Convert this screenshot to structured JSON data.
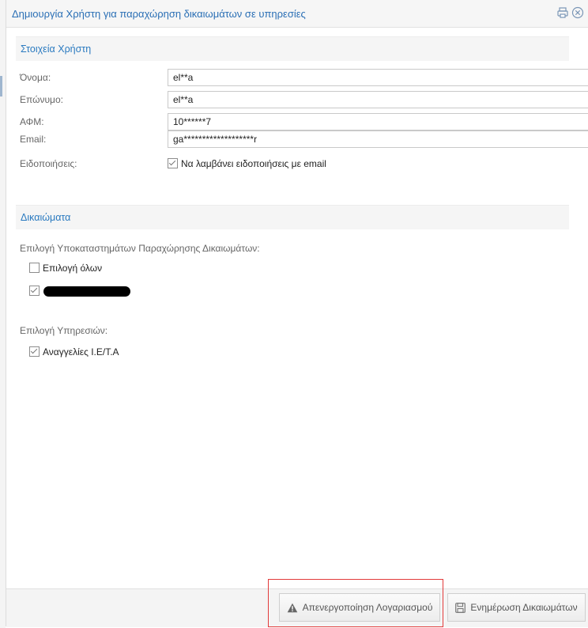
{
  "dialog": {
    "title": "Δημιουργία Χρήστη για παραχώρηση δικαιωμάτων σε υπηρεσίες",
    "icons": [
      "print-icon",
      "close-icon"
    ]
  },
  "user_section": {
    "title": "Στοιχεία Χρήστη",
    "fields": {
      "first_name": {
        "label": "Όνομα:",
        "value": "el**a"
      },
      "last_name": {
        "label": "Επώνυμο:",
        "value": "el**a"
      },
      "afm": {
        "label": "ΑΦΜ:",
        "value": "10******7"
      },
      "email": {
        "label": "Email:",
        "value": "ga*******************r"
      }
    },
    "notifications": {
      "label": "Ειδοποιήσεις:",
      "checkbox_label": "Να λαμβάνει ειδοποιήσεις με email",
      "checked": true
    }
  },
  "rights_section": {
    "title": "Δικαιώματα",
    "branches_label": "Επιλογή Υποκαταστημάτων Παραχώρησης Δικαιωμάτων:",
    "select_all_label": "Επιλογή όλων",
    "select_all_checked": false,
    "branch_checked": true,
    "services_label": "Επιλογή Υπηρεσιών:",
    "service_label": "Αναγγελίες Ι.Ε/Τ.Α",
    "service_checked": true
  },
  "footer": {
    "deactivate_label": "Απενεργοποίηση Λογαριασμού",
    "update_label": "Ενημέρωση Δικαιωμάτων"
  },
  "colors": {
    "title": "#2a6fb5",
    "section_title": "#2a7ac0",
    "highlight": "#e23b3b"
  }
}
